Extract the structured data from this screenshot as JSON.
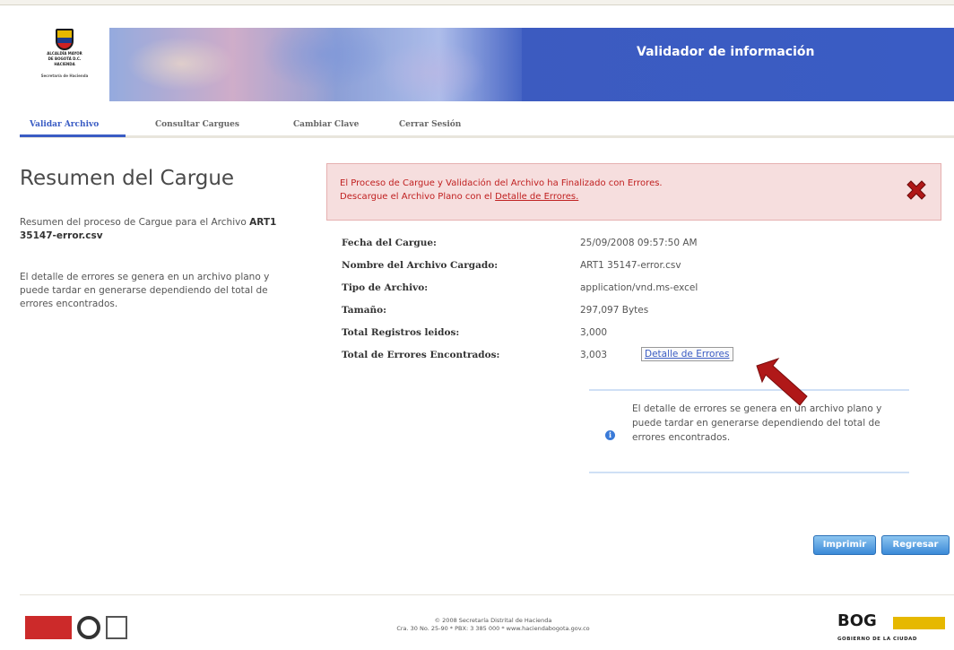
{
  "header": {
    "logo_lines": [
      "ALCALDÍA MAYOR",
      "DE BOGOTÁ D.C.",
      "HACIENDA",
      "Secretaría de Hacienda"
    ],
    "title": "Validador de información"
  },
  "nav": {
    "items": [
      {
        "label": "Validar Archivo",
        "active": true
      },
      {
        "label": "Consultar Cargues",
        "active": false
      },
      {
        "label": "Cambiar Clave",
        "active": false
      },
      {
        "label": "Cerrar Sesión",
        "active": false
      }
    ],
    "accent": "#3a5cc4"
  },
  "left": {
    "title": "Resumen del Cargue",
    "summary_prefix": "Resumen del proceso de Cargue para el Archivo",
    "file_name": "ART1 35147-error.csv",
    "note": "El detalle de errores se genera en un archivo plano y puede tardar en generarse dependiendo del total de errores encontrados."
  },
  "error_box": {
    "line1": "El Proceso de Cargue y Validación del Archivo ha Finalizado con Errores.",
    "line2_prefix": "Descargue el Archivo Plano con el",
    "link": "Detalle de Errores.",
    "icon": "close-x-icon",
    "bg_color": "#f6dede",
    "text_color": "#c02020"
  },
  "details": {
    "rows": [
      {
        "label": "Fecha del Cargue:",
        "value": "25/09/2008 09:57:50 AM"
      },
      {
        "label": "Nombre del Archivo Cargado:",
        "value": "ART1 35147-error.csv"
      },
      {
        "label": "Tipo de Archivo:",
        "value": "application/vnd.ms-excel"
      },
      {
        "label": "Tamaño:",
        "value": "297,097 Bytes"
      },
      {
        "label": "Total Registros leidos:",
        "value": "3,000"
      },
      {
        "label": "Total de Errores Encontrados:",
        "value": "3,003"
      }
    ],
    "detail_button": "Detalle de Errores"
  },
  "info": {
    "icon": "info-icon",
    "text": "El detalle de errores se genera en un archivo plano y puede tardar en generarse dependiendo del total de errores encontrados."
  },
  "buttons": {
    "print": "Imprimir",
    "back": "Regresar"
  },
  "footer": {
    "line1": "© 2008 Secretaría Distrital de Hacienda",
    "line2": "Cra. 30 No. 25-90 * PBX: 3 385 000 * www.haciendabogota.gov.co",
    "bog_logo_text": "BOG",
    "bog_sub": "GOBIERNO DE LA CIUDAD"
  }
}
